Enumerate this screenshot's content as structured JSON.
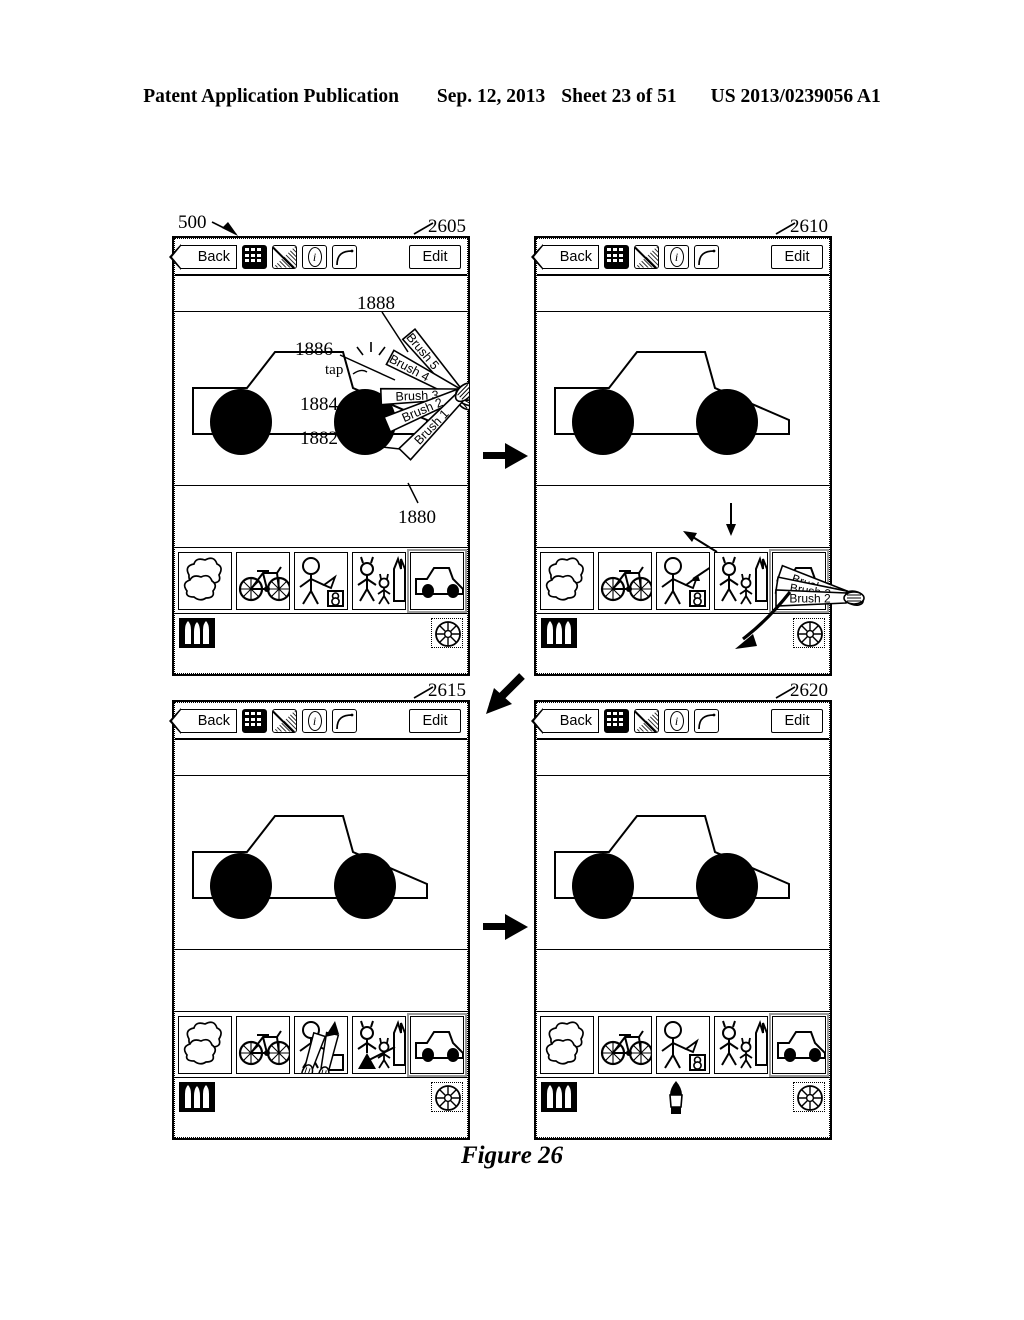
{
  "header": {
    "publication": "Patent Application Publication",
    "date": "Sep. 12, 2013",
    "sheet": "Sheet 23 of 51",
    "patent_number": "US 2013/0239056 A1"
  },
  "figure": {
    "caption": "Figure 26",
    "device_ref": "500",
    "panel_refs": [
      "2605",
      "2610",
      "2615",
      "2620"
    ],
    "brush_refs": [
      "1880",
      "1882",
      "1884",
      "1886",
      "1888"
    ],
    "gesture_label": "tap"
  },
  "toolbar": {
    "back_label": "Back",
    "edit_label": "Edit",
    "icons": [
      {
        "name": "grid-icon",
        "label": "grid"
      },
      {
        "name": "gradient-split-icon",
        "label": "gradient"
      },
      {
        "name": "info-oval-icon",
        "label": "i"
      },
      {
        "name": "curve-arc-icon",
        "label": "curve"
      }
    ]
  },
  "brush_fan": {
    "panel1_labels": [
      "Brush 5",
      "Brush 4",
      "Brush 3",
      "Brush 2",
      "Brush 1"
    ],
    "panel2_labels": [
      "Brush 4",
      "Brush 3",
      "Brush 2"
    ]
  },
  "thumbnails": [
    {
      "name": "thumbnail-clouds",
      "label": "clouds",
      "selected": false
    },
    {
      "name": "thumbnail-bicycle",
      "label": "bicycle",
      "selected": false
    },
    {
      "name": "thumbnail-kite-figure",
      "label": "stick figure with kite",
      "selected": false
    },
    {
      "name": "thumbnail-figures-buildings",
      "label": "stick figures with buildings",
      "selected": false
    },
    {
      "name": "thumbnail-car",
      "label": "car",
      "selected": true
    }
  ],
  "bottom_bar": {
    "brush_well_label": "brushes",
    "color_wheel_label": "color wheel"
  },
  "colors": {
    "ink": "#000000",
    "paper": "#ffffff",
    "selection": "#9a9a9a"
  }
}
